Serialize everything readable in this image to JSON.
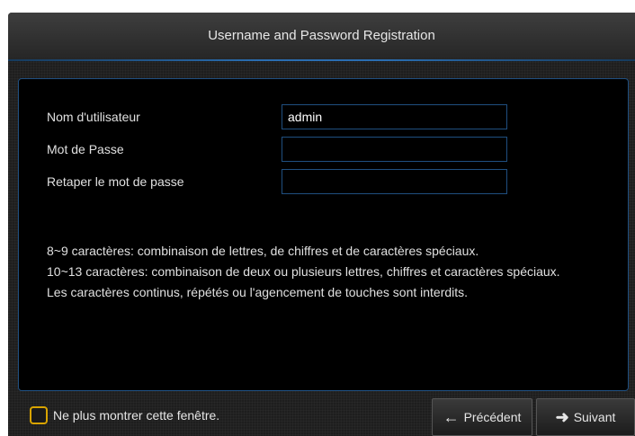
{
  "dialog": {
    "title": "Username and Password Registration"
  },
  "form": {
    "username": {
      "label": "Nom d'utilisateur",
      "value": "admin",
      "placeholder": ""
    },
    "password": {
      "label": "Mot de Passe",
      "value": "",
      "placeholder": ""
    },
    "confirm_password": {
      "label": "Retaper le mot de passe",
      "value": "",
      "placeholder": ""
    }
  },
  "notes": {
    "line1": "8~9 caractères: combinaison de lettres, de chiffres et de caractères spéciaux.",
    "line2": "10~13 caractères: combinaison de deux ou plusieurs lettres, chiffres et caractères spéciaux.",
    "line3": "Les caractères continus, répétés ou l'agencement de touches sont interdits."
  },
  "footer": {
    "dont_show_label": "Ne plus montrer cette fenêtre.",
    "dont_show_checked": false,
    "prev_label": "Précédent",
    "prev_icon": "arrow-left-icon",
    "next_label": "Suivant",
    "next_icon": "arrow-right-icon"
  },
  "colors": {
    "accent_blue": "#1f4f80",
    "checkbox_border": "#d9a400",
    "background": "#1e1e1e"
  }
}
